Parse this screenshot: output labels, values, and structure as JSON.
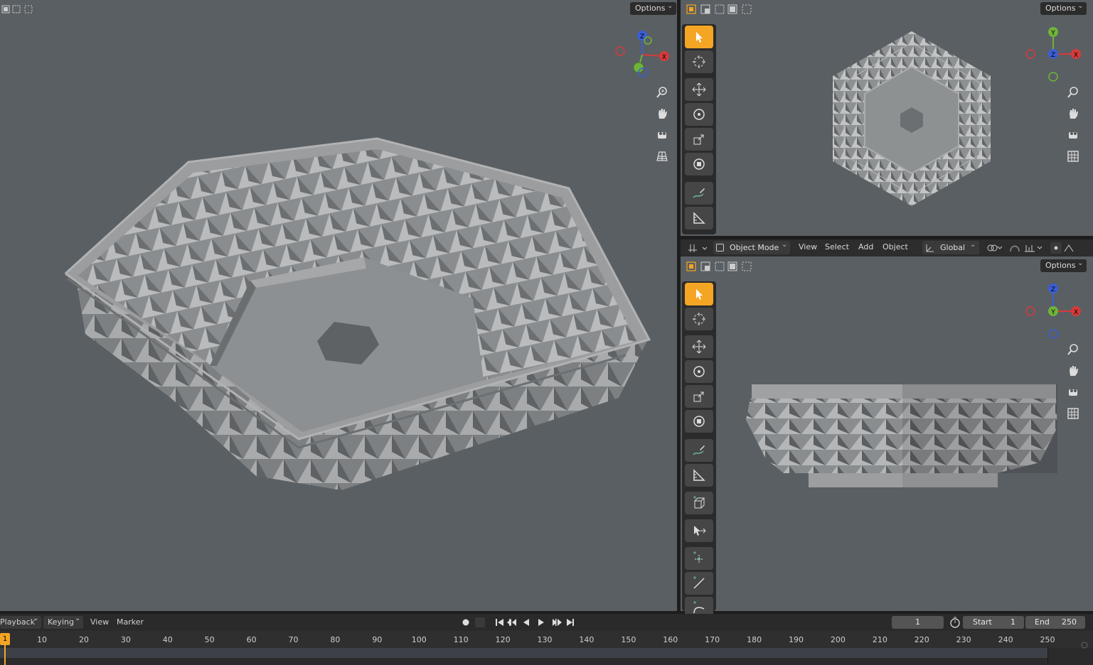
{
  "main_viewport": {
    "options_label": "Options"
  },
  "top_view": {
    "options_label": "Options"
  },
  "front_view": {
    "options_label": "Options"
  },
  "header": {
    "mode": "Object Mode",
    "menus": [
      "View",
      "Select",
      "Add",
      "Object"
    ],
    "transform_orientation": "Global"
  },
  "gizmo_labels": {
    "z": "Z",
    "x": "X",
    "y": "Y"
  },
  "timeline": {
    "menus": [
      "Playback",
      "Keying",
      "View",
      "Marker"
    ],
    "current_frame": "1",
    "start_label": "Start",
    "start_value": "1",
    "end_label": "End",
    "end_value": "250",
    "ticks": [
      "10",
      "20",
      "30",
      "40",
      "50",
      "60",
      "70",
      "80",
      "90",
      "100",
      "110",
      "120",
      "130",
      "140",
      "150",
      "160",
      "170",
      "180",
      "190",
      "200",
      "210",
      "220",
      "230",
      "240",
      "250"
    ],
    "playhead": "1"
  },
  "colors": {
    "viewport_bg": "#5a5f63",
    "active_tool": "#f5a524",
    "axis_x": "#d63a3a",
    "axis_y": "#6fb33a",
    "axis_z": "#3a5ed6"
  }
}
